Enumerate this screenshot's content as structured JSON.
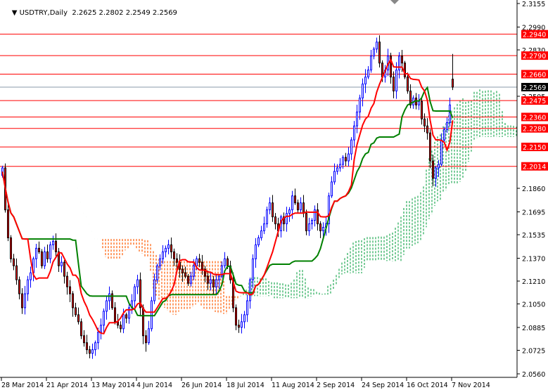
{
  "chart_data": {
    "type": "candlestick",
    "symbol": "USDTRY",
    "timeframe": "Daily",
    "header": {
      "open": "2.2625",
      "high": "2.2802",
      "low": "2.2549",
      "close": "2.2569"
    },
    "ylim": [
      2.056,
      2.3155
    ],
    "y_ticks": [
      "2.3155",
      "2.2990",
      "2.2830",
      "2.2505",
      "2.1860",
      "2.1695",
      "2.1535",
      "2.1370",
      "2.1210",
      "2.1050",
      "2.0885",
      "2.0725",
      "2.0560"
    ],
    "y_tick_values": [
      2.3155,
      2.299,
      2.283,
      2.2505,
      2.186,
      2.1695,
      2.1535,
      2.137,
      2.121,
      2.105,
      2.0885,
      2.0725,
      2.056
    ],
    "x_ticks": [
      "28 Mar 2014",
      "21 Apr 2014",
      "13 May 2014",
      "4 Jun 2014",
      "26 Jun 2014",
      "18 Jul 2014",
      "11 Aug 2014",
      "2 Sep 2014",
      "24 Sep 2014",
      "16 Oct 2014",
      "7 Nov 2014"
    ],
    "x_tick_bar_index": [
      0,
      16,
      32,
      48,
      64,
      80,
      96,
      112,
      128,
      144,
      160
    ],
    "levels": [
      {
        "label": "2.2940",
        "value": 2.294
      },
      {
        "label": "2.2790",
        "value": 2.279
      },
      {
        "label": "2.2660",
        "value": 2.266
      },
      {
        "label": "2.2475",
        "value": 2.2475
      },
      {
        "label": "2.2360",
        "value": 2.236
      },
      {
        "label": "2.2280",
        "value": 2.228
      },
      {
        "label": "2.2150",
        "value": 2.215
      },
      {
        "label": "2.2014",
        "value": 2.2014
      }
    ],
    "current_price": {
      "label": "2.2569",
      "value": 2.2569
    },
    "first_open": 2.195,
    "closes": [
      2.2003,
      2.1709,
      2.1513,
      2.1366,
      2.1317,
      2.1219,
      2.1121,
      2.1023,
      2.1121,
      2.1219,
      2.1268,
      2.1366,
      2.144,
      2.1415,
      2.1317,
      2.1415,
      2.1366,
      2.1464,
      2.1489,
      2.1415,
      2.1317,
      2.1342,
      2.1244,
      2.117,
      2.1121,
      2.1023,
      2.0974,
      2.0925,
      2.0827,
      2.0778,
      2.0729,
      2.0704,
      2.0729,
      2.0778,
      2.0852,
      2.0901,
      2.0999,
      2.1072,
      2.1121,
      2.1023,
      2.0925,
      2.0901,
      2.0876,
      2.0974,
      2.095,
      2.1023,
      2.1072,
      2.117,
      2.1219,
      2.1023,
      2.0827,
      2.0778,
      2.0876,
      2.1072,
      2.1219,
      2.1317,
      2.1366,
      2.1415,
      2.144,
      2.1464,
      2.1415,
      2.1366,
      2.1342,
      2.1293,
      2.1268,
      2.1244,
      2.1195,
      2.1244,
      2.1317,
      2.1366,
      2.1342,
      2.1293,
      2.1244,
      2.1195,
      2.1219,
      2.117,
      2.1219,
      2.1244,
      2.1317,
      2.1366,
      2.1317,
      2.1219,
      2.1023,
      2.0901,
      2.0886,
      2.0925,
      2.0974,
      2.1072,
      2.1219,
      2.1366,
      2.1464,
      2.1513,
      2.1562,
      2.1611,
      2.1709,
      2.1758,
      2.166,
      2.1611,
      2.1562,
      2.166,
      2.1611,
      2.1684,
      2.1709,
      2.1807,
      2.1758,
      2.1709,
      2.1758,
      2.1684,
      2.1562,
      2.1611,
      2.1636,
      2.1709,
      2.1611,
      2.1562,
      2.1587,
      2.1611,
      2.1807,
      2.1905,
      2.1979,
      2.2003,
      2.2028,
      2.2077,
      2.2052,
      2.2101,
      2.2199,
      2.2297,
      2.2395,
      2.2493,
      2.2591,
      2.264,
      2.2689,
      2.2787,
      2.2836,
      2.2885,
      2.2738,
      2.264,
      2.2689,
      2.2787,
      2.264,
      2.2542,
      2.2689,
      2.2787,
      2.2738,
      2.264,
      2.2542,
      2.2444,
      2.2493,
      2.2444,
      2.2469,
      2.2346,
      2.2297,
      2.2248,
      2.2052,
      2.193,
      2.2003,
      2.2028,
      2.2199,
      2.2272,
      2.2321,
      2.2444,
      2.2569
    ],
    "indicators": {
      "tenkan_period": 9,
      "kijun_period": 26,
      "shift": 26
    },
    "colors": {
      "bull": "#0000ff",
      "bear": "#ff0000",
      "tenkan": "#ff0000",
      "kijun": "#008000",
      "cloud_up": "#22aa55",
      "cloud_down": "#ff5a00",
      "level": "#ff0000",
      "price_label": "#000000"
    }
  }
}
